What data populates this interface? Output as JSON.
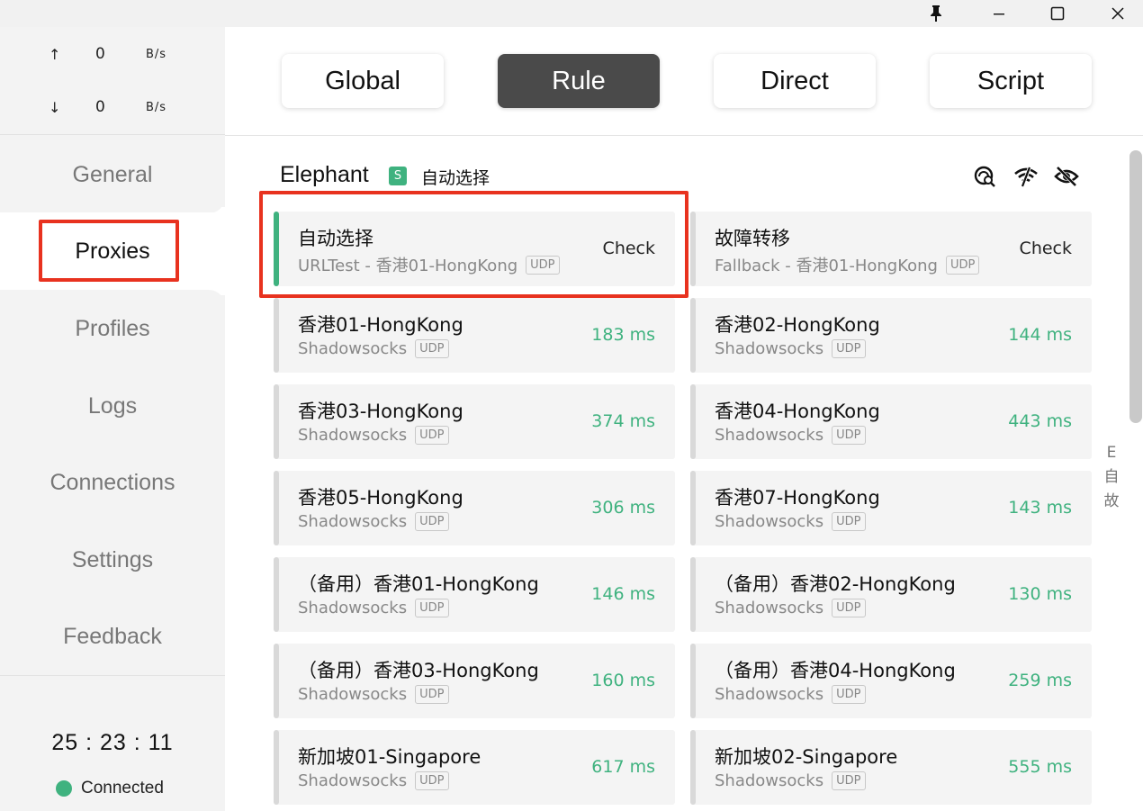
{
  "window": {
    "controls": [
      "pin-icon",
      "minimize-icon",
      "maximize-icon",
      "close-icon"
    ]
  },
  "traffic": {
    "up_arrow": "↑",
    "up_value": "0",
    "up_unit": "B/s",
    "down_arrow": "↓",
    "down_value": "0",
    "down_unit": "B/s"
  },
  "nav": {
    "items": [
      {
        "label": "General"
      },
      {
        "label": "Proxies"
      },
      {
        "label": "Profiles"
      },
      {
        "label": "Logs"
      },
      {
        "label": "Connections"
      },
      {
        "label": "Settings"
      },
      {
        "label": "Feedback"
      }
    ],
    "active": "Proxies"
  },
  "status": {
    "timer": "25 : 23 : 11",
    "connection": "Connected",
    "connection_color": "#3fb27f"
  },
  "modes": {
    "items": [
      {
        "label": "Global"
      },
      {
        "label": "Rule"
      },
      {
        "label": "Direct"
      },
      {
        "label": "Script"
      }
    ],
    "active": "Rule"
  },
  "group": {
    "name": "Elephant",
    "badge": "S",
    "current": "自动选择",
    "tools": [
      "latency-search-icon",
      "wifi-off-icon",
      "eye-off-icon"
    ]
  },
  "proxies": [
    {
      "name": "自动选择",
      "type": "URLTest - 香港01-HongKong",
      "udp": "UDP",
      "action": "Check",
      "selected": true
    },
    {
      "name": "故障转移",
      "type": "Fallback - 香港01-HongKong",
      "udp": "UDP",
      "action": "Check"
    },
    {
      "name": "香港01-HongKong",
      "type": "Shadowsocks",
      "udp": "UDP",
      "delay": "183 ms"
    },
    {
      "name": "香港02-HongKong",
      "type": "Shadowsocks",
      "udp": "UDP",
      "delay": "144 ms"
    },
    {
      "name": "香港03-HongKong",
      "type": "Shadowsocks",
      "udp": "UDP",
      "delay": "374 ms"
    },
    {
      "name": "香港04-HongKong",
      "type": "Shadowsocks",
      "udp": "UDP",
      "delay": "443 ms"
    },
    {
      "name": "香港05-HongKong",
      "type": "Shadowsocks",
      "udp": "UDP",
      "delay": "306 ms"
    },
    {
      "name": "香港07-HongKong",
      "type": "Shadowsocks",
      "udp": "UDP",
      "delay": "143 ms"
    },
    {
      "name": "（备用）香港01-HongKong",
      "type": "Shadowsocks",
      "udp": "UDP",
      "delay": "146 ms"
    },
    {
      "name": "（备用）香港02-HongKong",
      "type": "Shadowsocks",
      "udp": "UDP",
      "delay": "130 ms"
    },
    {
      "name": "（备用）香港03-HongKong",
      "type": "Shadowsocks",
      "udp": "UDP",
      "delay": "160 ms"
    },
    {
      "name": "（备用）香港04-HongKong",
      "type": "Shadowsocks",
      "udp": "UDP",
      "delay": "259 ms"
    },
    {
      "name": "新加坡01-Singapore",
      "type": "Shadowsocks",
      "udp": "UDP",
      "delay": "617 ms"
    },
    {
      "name": "新加坡02-Singapore",
      "type": "Shadowsocks",
      "udp": "UDP",
      "delay": "555 ms"
    }
  ],
  "side_index": [
    "E",
    "自",
    "故"
  ],
  "colors": {
    "accent": "#3fb27f",
    "highlight": "#e8321f",
    "active_mode": "#4a4a4a"
  }
}
